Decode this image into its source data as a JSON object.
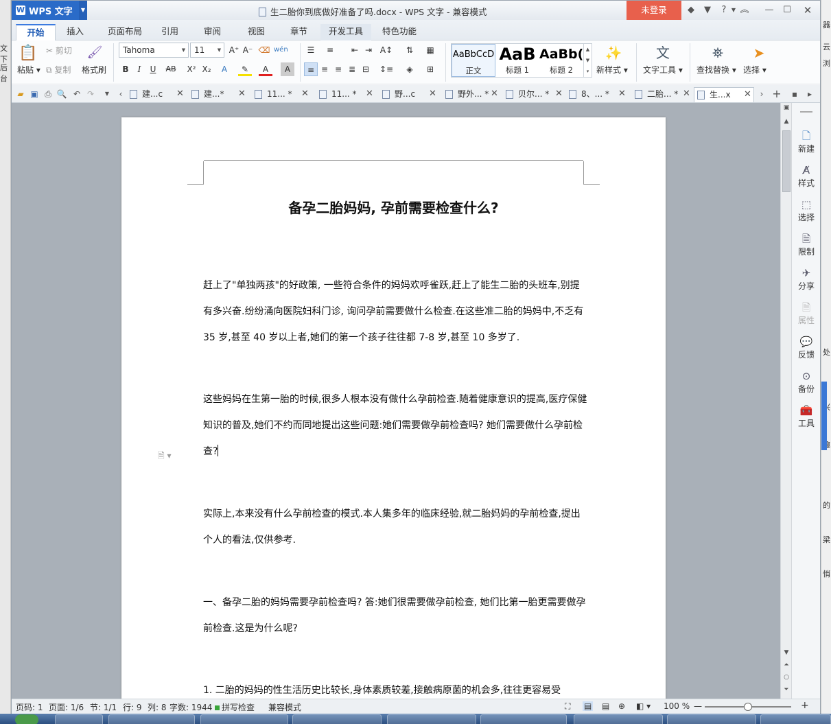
{
  "app": {
    "name": "WPS 文字"
  },
  "window": {
    "title": "生二胎你到底做好准备了吗.docx - WPS 文字 - 兼容模式",
    "login_label": "未登录",
    "help_label": "?"
  },
  "menu_tabs": [
    "开始",
    "插入",
    "页面布局",
    "引用",
    "审阅",
    "视图",
    "章节",
    "开发工具",
    "特色功能"
  ],
  "ribbon": {
    "paste": "粘贴",
    "cut": "剪切",
    "copy": "复制",
    "format_painter": "格式刷",
    "font_name": "Tahoma",
    "font_size": "11",
    "styles": [
      {
        "preview": "AaBbCcD",
        "label": "正文"
      },
      {
        "preview": "AaB",
        "label": "标题 1"
      },
      {
        "preview": "AaBb(",
        "label": "标题 2"
      }
    ],
    "new_style": "新样式",
    "text_tools": "文字工具",
    "find_replace": "查找替换",
    "select": "选择"
  },
  "doc_tabs": [
    {
      "label": "建...c"
    },
    {
      "label": "建...*"
    },
    {
      "label": "11... *"
    },
    {
      "label": "11... *"
    },
    {
      "label": "野...c"
    },
    {
      "label": "野外... *"
    },
    {
      "label": "贝尔... *"
    },
    {
      "label": "8、... *"
    },
    {
      "label": "二胎... *"
    },
    {
      "label": "生...x"
    }
  ],
  "document": {
    "title": "备孕二胎妈妈, 孕前需要检查什么?",
    "paragraphs": [
      "赶上了\"单独两孩\"的好政策, 一些符合条件的妈妈欢呼雀跃,赶上了能生二胎的头班车,别提有多兴奋.纷纷涌向医院妇科门诊, 询问孕前需要做什么检查.在这些准二胎的妈妈中,不乏有 35 岁,甚至 40 岁以上者,她们的第一个孩子往往都 7-8 岁,甚至 10 多岁了.",
      "这些妈妈在生第一胎的时候,很多人根本没有做什么孕前检查.随着健康意识的提高,医疗保健知识的普及,她们不约而同地提出这些问题:她们需要做孕前检查吗? 她们需要做什么孕前检查?",
      "实际上,本来没有什么孕前检查的模式.本人集多年的临床经验,就二胎妈妈的孕前检查,提出个人的看法,仅供参考.",
      "一、备孕二胎的妈妈需要孕前检查吗? 答:她们很需要做孕前检查, 她们比第一胎更需要做孕前检查.这是为什么呢?",
      "1. 二胎的妈妈的性生活历史比较长,身体素质较差,接触病原菌的机会多,往往更容易受"
    ]
  },
  "task_pane": [
    {
      "label": "新建",
      "icon": "new-doc-icon"
    },
    {
      "label": "样式",
      "icon": "style-icon"
    },
    {
      "label": "选择",
      "icon": "select-icon"
    },
    {
      "label": "限制",
      "icon": "restrict-icon"
    },
    {
      "label": "分享",
      "icon": "share-icon"
    },
    {
      "label": "属性",
      "icon": "properties-icon"
    },
    {
      "label": "反馈",
      "icon": "feedback-icon"
    },
    {
      "label": "备份",
      "icon": "backup-icon"
    },
    {
      "label": "工具",
      "icon": "toolbox-icon"
    }
  ],
  "status": {
    "page_code": "页码: 1",
    "pages": "页面: 1/6",
    "section": "节: 1/1",
    "row": "行: 9",
    "col": "列: 8",
    "words": "字数: 1944",
    "spell": "拼写检查",
    "compat": "兼容模式",
    "zoom": "100 %",
    "zoom_level": 0.5
  },
  "right_edge_text": [
    "器",
    "云",
    "浏",
    "的",
    "梁",
    "悄",
    "趣",
    "处",
    "兴"
  ],
  "left_edge_text": [
    "文下",
    "后台"
  ],
  "colors": {
    "accent": "#2a6bc8",
    "login": "#e8604c",
    "tab_active": "#3c7be0"
  }
}
